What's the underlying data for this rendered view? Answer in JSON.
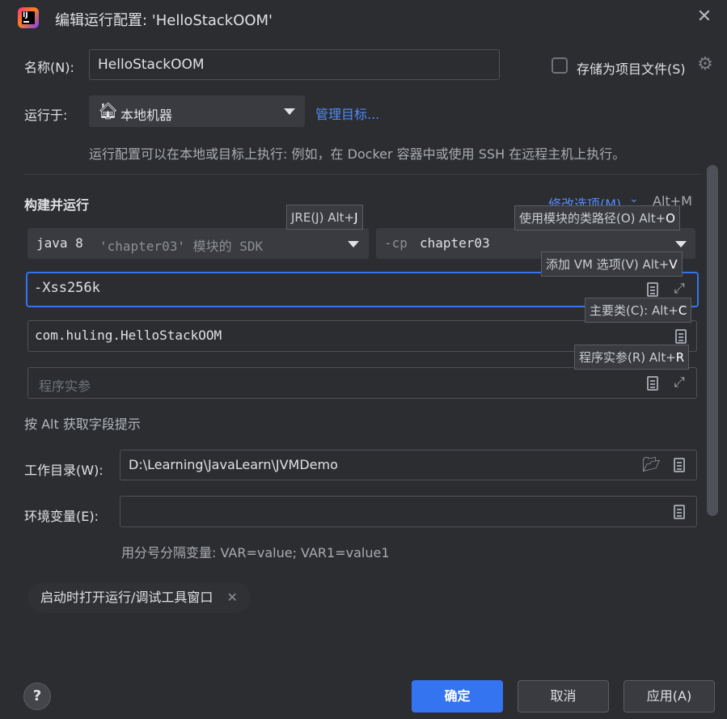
{
  "window": {
    "title": "编辑运行配置: 'HelloStackOOM'"
  },
  "name_row": {
    "label": "名称(N):",
    "value": "HelloStackOOM",
    "store_label": "存储为项目文件(S)"
  },
  "run_on": {
    "label": "运行于:",
    "value": "本地机器",
    "manage_link": "管理目标...",
    "hint": "运行配置可以在本地或目标上执行: 例如，在 Docker 容器中或使用 SSH 在远程主机上执行。"
  },
  "build_run": {
    "heading": "构建并运行",
    "modify_options": "修改选项(M)",
    "modify_shortcut": "Alt+M",
    "jre_prefix": "java 8",
    "jre_detail": "'chapter03' 模块的 SDK",
    "cp_prefix": "-cp",
    "cp_value": "chapter03",
    "vm_options": "-Xss256k",
    "main_class": "com.huling.HelloStackOOM",
    "program_args_placeholder": "程序实参",
    "alt_hint": "按 Alt 获取字段提示"
  },
  "tooltips": {
    "jre": {
      "text": "JRE(J) Alt+",
      "key": "J"
    },
    "classpath": {
      "text": "使用模块的类路径(O) Alt+",
      "key": "O"
    },
    "vm": {
      "text": "添加 VM 选项(V) Alt+",
      "key": "V"
    },
    "main_class": {
      "text": "主要类(C): Alt+",
      "key": "C"
    },
    "program_args": {
      "text": "程序实参(R) Alt+",
      "key": "R"
    }
  },
  "working_dir": {
    "label": "工作目录(W):",
    "value": "D:\\Learning\\JavaLearn\\JVMDemo"
  },
  "env_vars": {
    "label": "环境变量(E):",
    "value": "",
    "hint": "用分号分隔变量: VAR=value; VAR1=value1"
  },
  "chip": {
    "label": "启动时打开运行/调试工具窗口"
  },
  "buttons": {
    "help": "?",
    "ok": "确定",
    "cancel": "取消",
    "apply": "应用(A)"
  },
  "colors": {
    "background": "#2b2d30",
    "accent": "#3574f0",
    "link": "#548af7",
    "field": "#393b40"
  }
}
